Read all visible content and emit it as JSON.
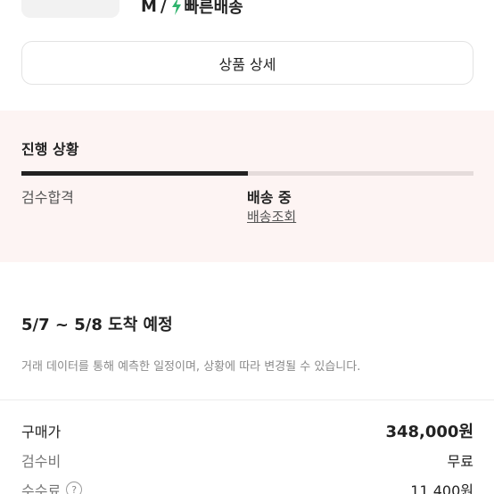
{
  "product": {
    "size": "M",
    "separator": "/",
    "fast_delivery_label": "빠른배송",
    "fast_delivery_color": "#31b46e"
  },
  "detail_button": {
    "label": "상품 상세"
  },
  "progress": {
    "title": "진행 상황",
    "progress_fraction": 0.5,
    "steps": [
      {
        "label": "검수합격",
        "status": "done"
      },
      {
        "label": "배송 중",
        "status": "current"
      }
    ],
    "track_link": "배송조회",
    "bar_color": "#222222",
    "track_color": "#e5dcdb",
    "bg_color": "#fdf4f3"
  },
  "arrival": {
    "title": "5/7 ~ 5/8 도착 예정",
    "note": "거래 데이터를 통해 예측한 일정이며, 상황에 따라 변경될 수 있습니다."
  },
  "price": {
    "rows": [
      {
        "label": "구매가",
        "value": "348,000원"
      },
      {
        "label": "검수비",
        "value": "무료"
      },
      {
        "label": "수수료",
        "value": "11,400원",
        "help_icon": "question-circle-icon",
        "help_symbol": "?"
      }
    ]
  }
}
